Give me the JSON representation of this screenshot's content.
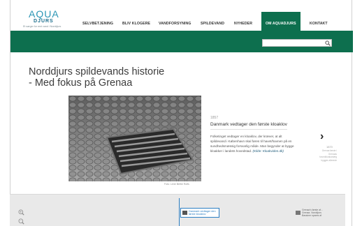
{
  "header": {
    "logo": {
      "brand": "AQUA",
      "sub": "DJURS",
      "tagline": "Et sørger for rent vand i Norddjurs"
    },
    "nav": {
      "items": [
        {
          "label": "SELVBETJENING"
        },
        {
          "label": "BLIV KLOGERE"
        },
        {
          "label": "VANDFORSYNING"
        },
        {
          "label": "SPILDEVAND"
        },
        {
          "label": "NYHEDER"
        },
        {
          "label": "OM AQUADJURS",
          "active": true
        },
        {
          "label": "KONTAKT"
        }
      ]
    },
    "search": {
      "value": "",
      "placeholder": ""
    }
  },
  "page": {
    "title_line1": "Norddjurs spildevands historie",
    "title_line2": "- Med fokus på Grenaa"
  },
  "slide": {
    "photo_credit": "Foto: Lene Bethe Rolfs",
    "year": "1857",
    "heading": "Danmark vedtager den første kloaklov",
    "body": "Folketinget vedtager en kloaklov, der kræver, at alt spildevand i København skal føres til havet/havnen på en sundhedsmæssig forsvarlig måde. Man begynder at bygge kloakker i landets hovedstad. ",
    "source": "(Kilde: Kloakviden.dk)"
  },
  "next": {
    "arrow": "›",
    "year": "1870",
    "preview": "Grenaa første i Grenaas hovedkloakanlæg bygges allerede"
  },
  "timeline": {
    "event1": "Danmark vedtager den første kloaklov",
    "event2_line1": "Grenaa's første af...",
    "event2_line2": "Grenaa. Norddjurs",
    "event2_line3": "Bassiner spares af"
  },
  "colors": {
    "brand_green": "#0d6f4e",
    "brand_blue": "#2b96b5",
    "timeline_blue": "#2b7ec2"
  }
}
